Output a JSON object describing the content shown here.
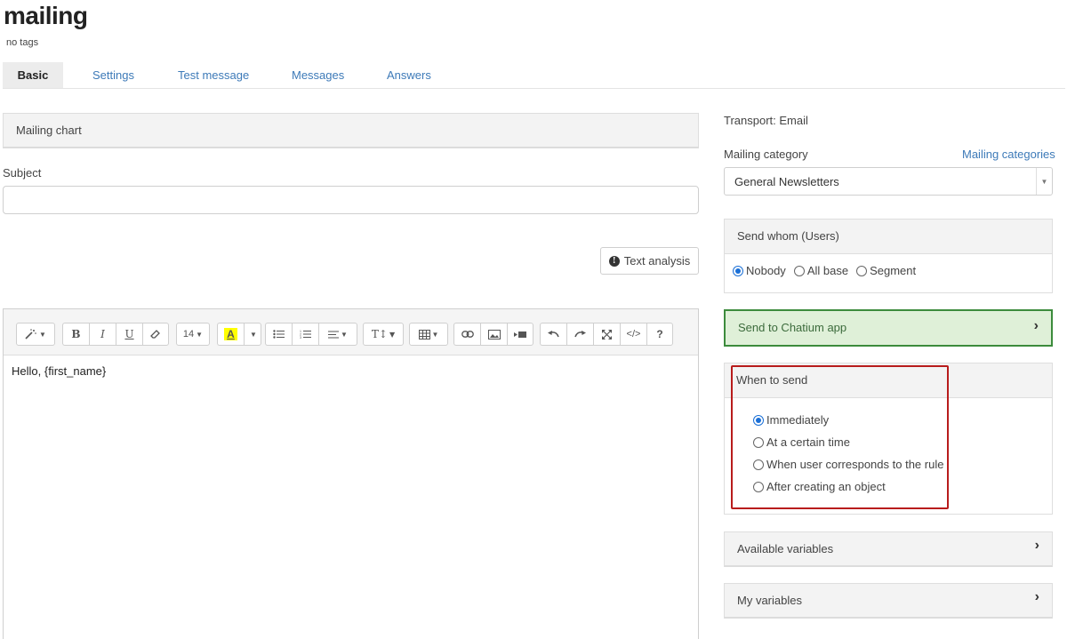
{
  "page": {
    "title": "mailing",
    "tags": "no tags"
  },
  "tabs": [
    {
      "label": "Basic",
      "active": true
    },
    {
      "label": "Settings"
    },
    {
      "label": "Test message"
    },
    {
      "label": "Messages"
    },
    {
      "label": "Answers"
    }
  ],
  "left": {
    "chart_header": "Mailing chart",
    "subject_label": "Subject",
    "subject_value": "",
    "text_analysis_label": "Text analysis"
  },
  "toolbar": {
    "font_size": "14",
    "text_style": "T↕",
    "bold": "B",
    "italic": "I",
    "underline": "U",
    "highlight": "A",
    "help": "?",
    "code": "</>"
  },
  "editor": {
    "content": "Hello, {first_name}"
  },
  "right": {
    "transport": "Transport: Email",
    "category_label": "Mailing category",
    "categories_link": "Mailing categories",
    "category_value": "General Newsletters",
    "send_whom": {
      "header": "Send whom (Users)",
      "options": [
        "Nobody",
        "All base",
        "Segment"
      ],
      "selected": "Nobody"
    },
    "chatium_label": "Send to Chatium app",
    "when_to_send": {
      "header": "When to send",
      "options": [
        "Immediately",
        "At a certain time",
        "When user corresponds to the rule",
        "After creating an object"
      ],
      "selected": "Immediately"
    },
    "available_variables": "Available variables",
    "my_variables": "My variables"
  },
  "colors": {
    "link": "#3d7ab8",
    "highlight_border": "#b81c1c",
    "chatium_bg": "#dff0d8",
    "radio_on": "#1a6fd6"
  }
}
